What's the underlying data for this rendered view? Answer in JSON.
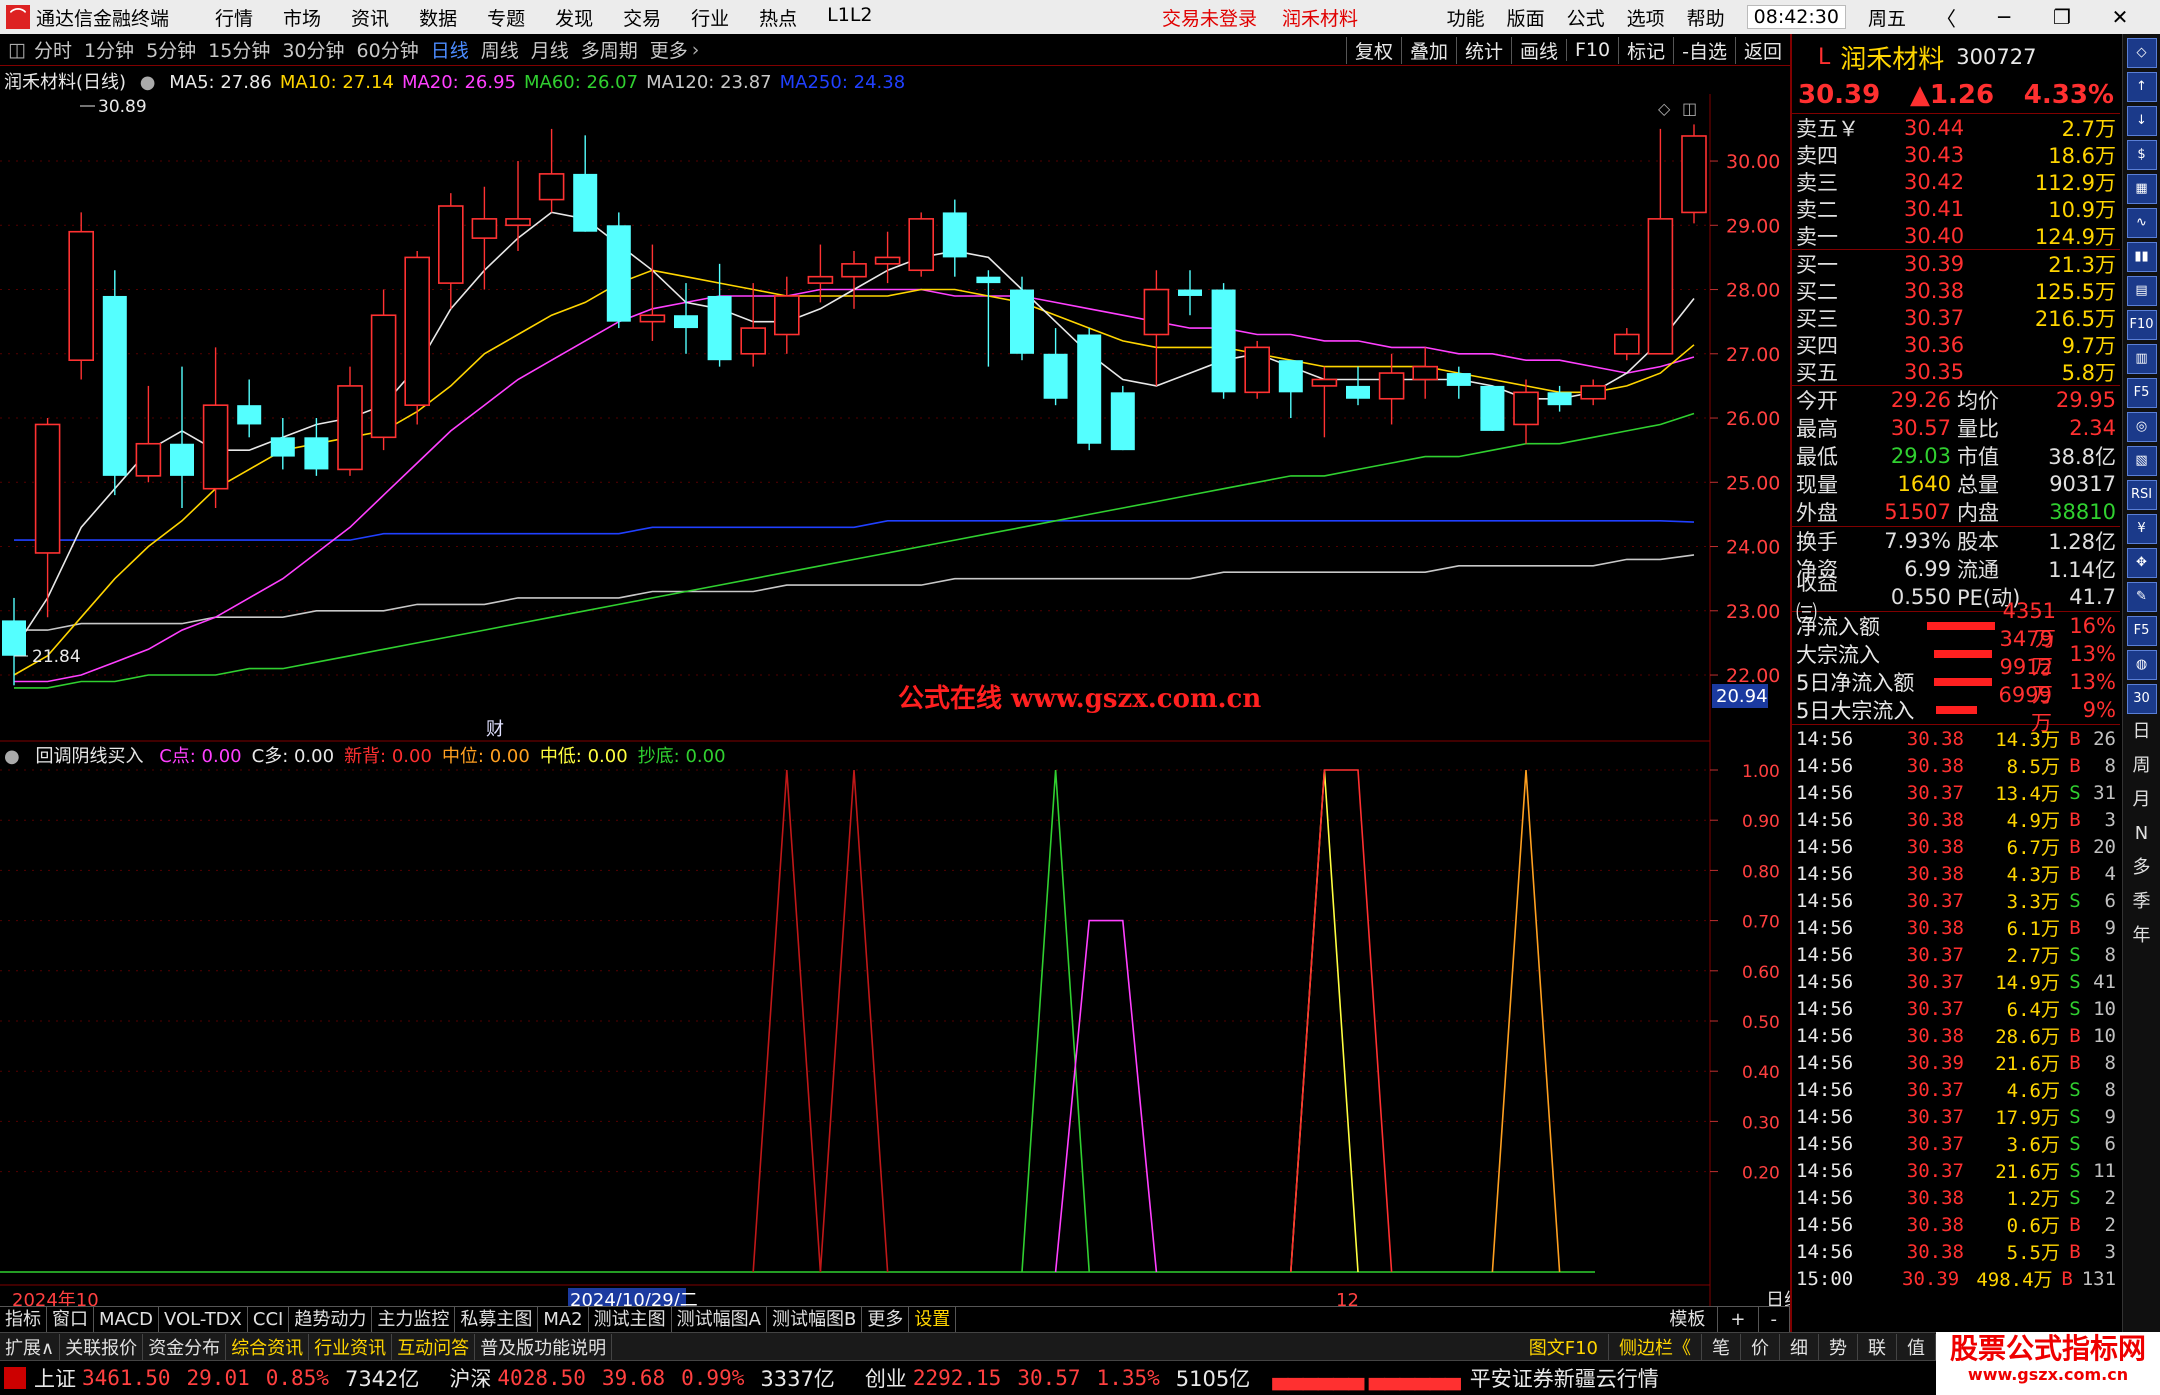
{
  "menubar": {
    "app_name": "通达信金融终端",
    "items": [
      "行情",
      "市场",
      "资讯",
      "数据",
      "专题",
      "发现",
      "交易",
      "行业",
      "热点",
      "L1L2"
    ],
    "trade_status": "交易未登录",
    "stock_name": "润禾材料",
    "right_items": [
      "功能",
      "版面",
      "公式",
      "选项",
      "帮助"
    ],
    "time": "08:42:30",
    "weekday": "周五"
  },
  "period_bar": {
    "items": [
      "分时",
      "1分钟",
      "5分钟",
      "15分钟",
      "30分钟",
      "60分钟",
      "日线",
      "周线",
      "月线",
      "多周期",
      "更多"
    ],
    "active": "日线",
    "tools": [
      "复权",
      "叠加",
      "统计",
      "画线",
      "F10",
      "标记",
      "-自选",
      "返回"
    ]
  },
  "ma_legend": {
    "title": "润禾材料(日线)",
    "items": [
      {
        "label": "MA5: 27.86",
        "color": "#e8e8e8"
      },
      {
        "label": "MA10: 27.14",
        "color": "#ffd500"
      },
      {
        "label": "MA20: 26.95",
        "color": "#ff40ff"
      },
      {
        "label": "MA60: 26.07",
        "color": "#30d030"
      },
      {
        "label": "MA120: 23.87",
        "color": "#c8c8c8"
      },
      {
        "label": "MA250: 24.38",
        "color": "#2040ff"
      }
    ]
  },
  "main_chart": {
    "y_ticks": [
      "30.00",
      "29.00",
      "28.00",
      "27.00",
      "26.00",
      "25.00",
      "24.00",
      "23.00",
      "22.00"
    ],
    "y_values": [
      30,
      29,
      28,
      27,
      26,
      25,
      24,
      23,
      22
    ],
    "high_label": "30.89",
    "low_label": "21.84",
    "current_price_tag": "20.94",
    "event_marker": "财",
    "watermark": "公式在线  www.gszx.com.cn",
    "candles": [
      [
        22.85,
        22.3,
        23.2,
        21.84
      ],
      [
        23.9,
        25.9,
        26.0,
        22.9
      ],
      [
        26.9,
        28.9,
        29.2,
        26.6
      ],
      [
        27.9,
        25.1,
        28.3,
        24.8
      ],
      [
        25.1,
        25.6,
        26.5,
        25.0
      ],
      [
        25.6,
        25.1,
        26.8,
        24.6
      ],
      [
        24.9,
        26.2,
        27.1,
        24.6
      ],
      [
        26.2,
        25.9,
        26.6,
        25.7
      ],
      [
        25.7,
        25.4,
        26.0,
        25.2
      ],
      [
        25.7,
        25.2,
        26.0,
        25.1
      ],
      [
        25.2,
        26.5,
        26.8,
        25.1
      ],
      [
        25.7,
        27.6,
        28.0,
        25.5
      ],
      [
        26.2,
        28.5,
        28.6,
        25.9
      ],
      [
        28.1,
        29.3,
        29.5,
        27.7
      ],
      [
        28.8,
        29.1,
        29.6,
        28.0
      ],
      [
        29.0,
        29.1,
        30.0,
        28.6
      ],
      [
        29.4,
        29.8,
        30.5,
        29.2
      ],
      [
        29.8,
        28.9,
        30.4,
        28.9
      ],
      [
        29.0,
        27.5,
        29.2,
        27.4
      ],
      [
        27.5,
        27.6,
        28.7,
        27.2
      ],
      [
        27.6,
        27.4,
        28.1,
        27.0
      ],
      [
        27.9,
        26.9,
        28.4,
        26.8
      ],
      [
        27.0,
        27.4,
        28.1,
        26.8
      ],
      [
        27.3,
        27.9,
        28.2,
        27.0
      ],
      [
        28.1,
        28.2,
        28.7,
        27.8
      ],
      [
        28.2,
        28.4,
        28.6,
        27.7
      ],
      [
        28.4,
        28.5,
        28.9,
        28.1
      ],
      [
        28.3,
        29.1,
        29.2,
        28.2
      ],
      [
        29.2,
        28.5,
        29.4,
        28.2
      ],
      [
        28.2,
        28.1,
        28.3,
        26.8
      ],
      [
        28.0,
        27.0,
        28.2,
        26.9
      ],
      [
        27.0,
        26.3,
        27.4,
        26.2
      ],
      [
        27.3,
        25.6,
        27.4,
        25.5
      ],
      [
        26.4,
        25.5,
        26.5,
        25.5
      ],
      [
        27.3,
        28.0,
        28.3,
        26.5
      ],
      [
        28.0,
        27.9,
        28.3,
        27.6
      ],
      [
        28.0,
        26.4,
        28.1,
        26.3
      ],
      [
        26.4,
        27.1,
        27.2,
        26.3
      ],
      [
        26.9,
        26.4,
        26.9,
        26.0
      ],
      [
        26.5,
        26.6,
        26.8,
        25.7
      ],
      [
        26.5,
        26.3,
        26.8,
        26.2
      ],
      [
        26.3,
        26.7,
        27.0,
        25.9
      ],
      [
        26.6,
        26.8,
        27.1,
        26.3
      ],
      [
        26.7,
        26.5,
        26.8,
        26.3
      ],
      [
        26.5,
        25.8,
        26.5,
        25.8
      ],
      [
        25.9,
        26.4,
        26.6,
        25.6
      ],
      [
        26.4,
        26.2,
        26.5,
        26.1
      ],
      [
        26.3,
        26.5,
        26.6,
        26.2
      ],
      [
        27.0,
        27.3,
        27.4,
        26.9
      ],
      [
        27.0,
        29.1,
        30.5,
        27.0
      ],
      [
        29.2,
        30.39,
        30.57,
        29.03
      ]
    ],
    "ma5": [
      22.4,
      23.2,
      24.3,
      24.9,
      25.5,
      25.8,
      25.5,
      25.5,
      25.7,
      25.9,
      26.0,
      26.2,
      26.8,
      27.7,
      28.3,
      28.8,
      29.2,
      29.1,
      28.7,
      28.3,
      27.8,
      27.7,
      27.5,
      27.5,
      27.7,
      28.0,
      28.3,
      28.5,
      28.6,
      28.5,
      28.0,
      27.5,
      27.0,
      26.6,
      26.5,
      26.7,
      26.9,
      27.0,
      26.8,
      26.6,
      26.6,
      26.6,
      26.6,
      26.6,
      26.5,
      26.3,
      26.3,
      26.4,
      26.7,
      27.2,
      27.86
    ],
    "ma10": [
      22.0,
      22.3,
      22.9,
      23.5,
      24.0,
      24.4,
      24.9,
      25.2,
      25.5,
      25.6,
      25.7,
      25.8,
      26.1,
      26.5,
      27.0,
      27.3,
      27.6,
      27.8,
      28.1,
      28.3,
      28.2,
      28.1,
      28.0,
      27.9,
      27.9,
      27.9,
      27.9,
      28.0,
      28.0,
      27.9,
      27.8,
      27.6,
      27.4,
      27.2,
      27.1,
      27.1,
      27.1,
      27.0,
      26.9,
      26.8,
      26.8,
      26.8,
      26.8,
      26.7,
      26.6,
      26.5,
      26.4,
      26.4,
      26.5,
      26.7,
      27.14
    ],
    "ma20": [
      21.9,
      21.9,
      22.0,
      22.2,
      22.4,
      22.7,
      22.9,
      23.2,
      23.5,
      23.9,
      24.3,
      24.8,
      25.3,
      25.8,
      26.2,
      26.6,
      26.9,
      27.2,
      27.5,
      27.7,
      27.8,
      27.9,
      27.9,
      27.9,
      28.0,
      28.0,
      28.0,
      28.0,
      27.9,
      27.9,
      27.9,
      27.8,
      27.7,
      27.6,
      27.5,
      27.4,
      27.4,
      27.3,
      27.3,
      27.2,
      27.2,
      27.1,
      27.1,
      27.0,
      27.0,
      26.9,
      26.9,
      26.8,
      26.7,
      26.8,
      26.95
    ],
    "ma60": [
      21.8,
      21.8,
      21.9,
      21.9,
      22.0,
      22.0,
      22.0,
      22.1,
      22.1,
      22.2,
      22.3,
      22.4,
      22.5,
      22.6,
      22.7,
      22.8,
      22.9,
      23.0,
      23.1,
      23.2,
      23.3,
      23.4,
      23.5,
      23.6,
      23.7,
      23.8,
      23.9,
      24.0,
      24.1,
      24.2,
      24.3,
      24.4,
      24.5,
      24.6,
      24.7,
      24.8,
      24.9,
      25.0,
      25.1,
      25.1,
      25.2,
      25.3,
      25.4,
      25.4,
      25.5,
      25.6,
      25.6,
      25.7,
      25.8,
      25.9,
      26.07
    ],
    "ma120": [
      22.7,
      22.7,
      22.8,
      22.8,
      22.8,
      22.8,
      22.9,
      22.9,
      22.9,
      23.0,
      23.0,
      23.0,
      23.1,
      23.1,
      23.1,
      23.2,
      23.2,
      23.2,
      23.2,
      23.3,
      23.3,
      23.3,
      23.3,
      23.4,
      23.4,
      23.4,
      23.4,
      23.4,
      23.5,
      23.5,
      23.5,
      23.5,
      23.5,
      23.5,
      23.5,
      23.5,
      23.6,
      23.6,
      23.6,
      23.6,
      23.6,
      23.6,
      23.6,
      23.7,
      23.7,
      23.7,
      23.7,
      23.7,
      23.8,
      23.8,
      23.87
    ],
    "ma250": [
      24.1,
      24.1,
      24.1,
      24.1,
      24.1,
      24.1,
      24.1,
      24.1,
      24.1,
      24.1,
      24.1,
      24.2,
      24.2,
      24.2,
      24.2,
      24.2,
      24.2,
      24.2,
      24.2,
      24.3,
      24.3,
      24.3,
      24.3,
      24.3,
      24.3,
      24.3,
      24.4,
      24.4,
      24.4,
      24.4,
      24.4,
      24.4,
      24.4,
      24.4,
      24.4,
      24.4,
      24.4,
      24.4,
      24.4,
      24.4,
      24.4,
      24.4,
      24.4,
      24.4,
      24.4,
      24.4,
      24.4,
      24.4,
      24.4,
      24.4,
      24.38
    ]
  },
  "sub_legend": {
    "title": "回调阴线买入",
    "items": [
      {
        "label": "C点: 0.00",
        "color": "#ff40ff"
      },
      {
        "label": "C多: 0.00",
        "color": "#e8e8e8"
      },
      {
        "label": "新背: 0.00",
        "color": "#ff3030"
      },
      {
        "label": "中位: 0.00",
        "color": "#ffa020"
      },
      {
        "label": "中低: 0.00",
        "color": "#ffff40"
      },
      {
        "label": "抄底: 0.00",
        "color": "#30d030"
      }
    ]
  },
  "sub_chart": {
    "y_ticks": [
      "1.00",
      "0.90",
      "0.80",
      "0.70",
      "0.60",
      "0.50",
      "0.40",
      "0.30",
      "0.20"
    ],
    "y_values": [
      1.0,
      0.9,
      0.8,
      0.7,
      0.6,
      0.5,
      0.4,
      0.3,
      0.2
    ],
    "x_labels": [
      "2024年10",
      "2024/10/29/二",
      "12"
    ],
    "peaks": [
      {
        "series": "新背",
        "color": "#c01818",
        "start": 22,
        "top": [
          23,
          23
        ],
        "end": 24,
        "value": 1.0
      },
      {
        "series": "新背",
        "color": "#c01818",
        "start": 24,
        "top": [
          25,
          25
        ],
        "end": 26,
        "value": 1.0
      },
      {
        "series": "抄底",
        "color": "#30d030",
        "start": 30,
        "top": [
          31,
          31
        ],
        "end": 32,
        "value": 1.0
      },
      {
        "series": "C点",
        "color": "#ff40ff",
        "start": 31,
        "top": [
          32,
          33
        ],
        "end": 34,
        "value": 0.7
      },
      {
        "series": "中低",
        "color": "#ffff40",
        "start": 38,
        "top": [
          39,
          39
        ],
        "end": 40,
        "value": 1.0
      },
      {
        "series": "中位",
        "color": "#ff3030",
        "start": 38,
        "top": [
          39,
          40
        ],
        "end": 41,
        "value": 1.0
      },
      {
        "series": "中位",
        "color": "#ffa020",
        "start": 44,
        "top": [
          45,
          45
        ],
        "end": 46,
        "value": 1.0
      }
    ]
  },
  "tabs": {
    "items": [
      "指标",
      "窗口",
      "MACD",
      "VOL-TDX",
      "CCI",
      "趋势动力",
      "主力监控",
      "私募主图",
      "MA2",
      "测试主图",
      "测试幅图A",
      "测试幅图B",
      "更多",
      "设置"
    ],
    "selected": "设置",
    "right": [
      "模板",
      "+",
      "-"
    ]
  },
  "statusbar1": {
    "items": [
      "扩展∧",
      "关联报价",
      "资金分布",
      "综合资讯",
      "行业资讯",
      "互动问答",
      "普及版功能说明"
    ],
    "highlight": [
      "综合资讯",
      "行业资讯",
      "互动问答"
    ],
    "right": [
      "图文F10",
      "侧边栏《",
      "笔",
      "价",
      "细",
      "势",
      "联",
      "值"
    ]
  },
  "statusbar2": {
    "indices": [
      {
        "name": "上证",
        "value": "3461.50",
        "chg": "29.01",
        "pct": "0.85%",
        "amt": "7342亿"
      },
      {
        "name": "沪深",
        "value": "4028.50",
        "chg": "39.68",
        "pct": "0.99%",
        "amt": "3337亿"
      },
      {
        "name": "创业",
        "value": "2292.15",
        "chg": "30.57",
        "pct": "1.35%",
        "amt": "5105亿"
      }
    ],
    "network": "平安证券新疆云行情"
  },
  "rpanel": {
    "name": "润禾材料",
    "code": "300727",
    "price": "30.39",
    "change": "▲1.26",
    "pct": "4.33%",
    "asks": [
      {
        "label": "卖五￥",
        "price": "30.44",
        "vol": "2.7万"
      },
      {
        "label": "卖四",
        "price": "30.43",
        "vol": "18.6万"
      },
      {
        "label": "卖三",
        "price": "30.42",
        "vol": "112.9万"
      },
      {
        "label": "卖二",
        "price": "30.41",
        "vol": "10.9万"
      },
      {
        "label": "卖一",
        "price": "30.40",
        "vol": "124.9万"
      }
    ],
    "bids": [
      {
        "label": "买一",
        "price": "30.39",
        "vol": "21.3万"
      },
      {
        "label": "买二",
        "price": "30.38",
        "vol": "125.5万"
      },
      {
        "label": "买三",
        "price": "30.37",
        "vol": "216.5万"
      },
      {
        "label": "买四",
        "price": "30.36",
        "vol": "9.7万"
      },
      {
        "label": "买五",
        "price": "30.35",
        "vol": "5.8万"
      }
    ],
    "stats1": [
      {
        "k1": "今开",
        "v1": "29.26",
        "c1": "#ff3030",
        "k2": "均价",
        "v2": "29.95",
        "c2": "#ff3030"
      },
      {
        "k1": "最高",
        "v1": "30.57",
        "c1": "#ff3030",
        "k2": "量比",
        "v2": "2.34",
        "c2": "#ff3030"
      },
      {
        "k1": "最低",
        "v1": "29.03",
        "c1": "#30d030",
        "k2": "市值",
        "v2": "38.8亿",
        "c2": "#e0e0e0"
      },
      {
        "k1": "现量",
        "v1": "1640",
        "c1": "#ffd500",
        "k2": "总量",
        "v2": "90317",
        "c2": "#e0e0e0"
      },
      {
        "k1": "外盘",
        "v1": "51507",
        "c1": "#ff3030",
        "k2": "内盘",
        "v2": "38810",
        "c2": "#30d030"
      }
    ],
    "stats2": [
      {
        "k1": "换手",
        "v1": "7.93%",
        "c1": "#e0e0e0",
        "k2": "股本",
        "v2": "1.28亿",
        "c2": "#e0e0e0"
      },
      {
        "k1": "净资",
        "v1": "6.99",
        "c1": "#e0e0e0",
        "k2": "流通",
        "v2": "1.14亿",
        "c2": "#e0e0e0"
      },
      {
        "k1": "收益㈢",
        "v1": "0.550",
        "c1": "#e0e0e0",
        "k2": "PE(动)",
        "v2": "41.7",
        "c2": "#e0e0e0"
      }
    ],
    "flows": [
      {
        "k": "净流入额",
        "bar": 16,
        "v": "4351万",
        "pc": "16%"
      },
      {
        "k": "大宗流入",
        "bar": 13,
        "v": "3479万",
        "pc": "13%"
      },
      {
        "k": "5日净流入额",
        "bar": 13,
        "v": "9912万",
        "pc": "13%"
      },
      {
        "k": "5日大宗流入",
        "bar": 9,
        "v": "6999万",
        "pc": "9%"
      }
    ],
    "ticks": [
      {
        "t": "14:56",
        "p": "30.38",
        "v": "14.3万",
        "bs": "B",
        "n": "26"
      },
      {
        "t": "14:56",
        "p": "30.38",
        "v": "8.5万",
        "bs": "B",
        "n": "8"
      },
      {
        "t": "14:56",
        "p": "30.37",
        "v": "13.4万",
        "bs": "S",
        "n": "31"
      },
      {
        "t": "14:56",
        "p": "30.38",
        "v": "4.9万",
        "bs": "B",
        "n": "3"
      },
      {
        "t": "14:56",
        "p": "30.38",
        "v": "6.7万",
        "bs": "B",
        "n": "20"
      },
      {
        "t": "14:56",
        "p": "30.38",
        "v": "4.3万",
        "bs": "B",
        "n": "4"
      },
      {
        "t": "14:56",
        "p": "30.37",
        "v": "3.3万",
        "bs": "S",
        "n": "6"
      },
      {
        "t": "14:56",
        "p": "30.38",
        "v": "6.1万",
        "bs": "B",
        "n": "9"
      },
      {
        "t": "14:56",
        "p": "30.37",
        "v": "2.7万",
        "bs": "S",
        "n": "8"
      },
      {
        "t": "14:56",
        "p": "30.37",
        "v": "14.9万",
        "bs": "S",
        "n": "41"
      },
      {
        "t": "14:56",
        "p": "30.37",
        "v": "6.4万",
        "bs": "S",
        "n": "10"
      },
      {
        "t": "14:56",
        "p": "30.38",
        "v": "28.6万",
        "bs": "B",
        "n": "10"
      },
      {
        "t": "14:56",
        "p": "30.39",
        "v": "21.6万",
        "bs": "B",
        "n": "8"
      },
      {
        "t": "14:56",
        "p": "30.37",
        "v": "4.6万",
        "bs": "S",
        "n": "8"
      },
      {
        "t": "14:56",
        "p": "30.37",
        "v": "17.9万",
        "bs": "S",
        "n": "9"
      },
      {
        "t": "14:56",
        "p": "30.37",
        "v": "3.6万",
        "bs": "S",
        "n": "6"
      },
      {
        "t": "14:56",
        "p": "30.37",
        "v": "21.6万",
        "bs": "S",
        "n": "11"
      },
      {
        "t": "14:56",
        "p": "30.38",
        "v": "1.2万",
        "bs": "S",
        "n": "2"
      },
      {
        "t": "14:56",
        "p": "30.38",
        "v": "0.6万",
        "bs": "B",
        "n": "2"
      },
      {
        "t": "14:56",
        "p": "30.38",
        "v": "5.5万",
        "bs": "B",
        "n": "3"
      },
      {
        "t": "15:00",
        "p": "30.39",
        "v": "498.4万",
        "bs": "B",
        "n": "131"
      }
    ]
  },
  "iconstrip": {
    "icons": [
      "◇",
      "↑",
      "↓",
      "$",
      "▦",
      "∿",
      "▮▮",
      "▤",
      "F10",
      "▥",
      "F5",
      "◎",
      "▧",
      "RSI",
      "¥",
      "✥",
      "✎",
      "F5",
      "◍",
      "30"
    ],
    "periods": [
      "日",
      "周",
      "月",
      "N",
      "多",
      "季",
      "年"
    ]
  },
  "corner_logo": {
    "title": "股票公式指标网",
    "url": "www.gszx.com.cn"
  }
}
